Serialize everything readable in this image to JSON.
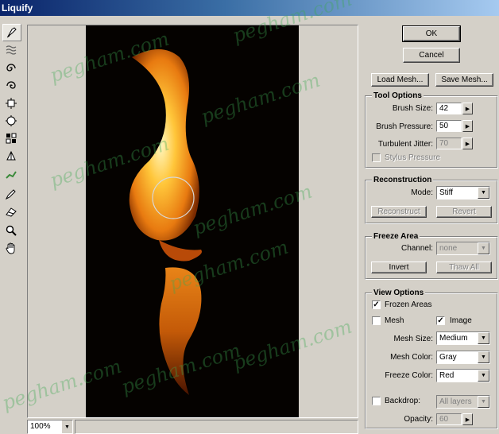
{
  "window": {
    "title": "Liquify"
  },
  "buttons": {
    "ok": "OK",
    "cancel": "Cancel",
    "load_mesh": "Load Mesh...",
    "save_mesh": "Save Mesh..."
  },
  "tool_options": {
    "title": "Tool Options",
    "brush_size_label": "Brush Size:",
    "brush_size_value": "42",
    "brush_pressure_label": "Brush Pressure:",
    "brush_pressure_value": "50",
    "turbulent_jitter_label": "Turbulent Jitter:",
    "turbulent_jitter_value": "70",
    "stylus_pressure_label": "Stylus Pressure"
  },
  "reconstruction": {
    "title": "Reconstruction",
    "mode_label": "Mode:",
    "mode_value": "Stiff",
    "reconstruct_label": "Reconstruct",
    "revert_label": "Revert"
  },
  "freeze_area": {
    "title": "Freeze Area",
    "channel_label": "Channel:",
    "channel_value": "none",
    "invert_label": "Invert",
    "thaw_all_label": "Thaw All"
  },
  "view_options": {
    "title": "View Options",
    "frozen_areas_label": "Frozen Areas",
    "frozen_areas_checked": true,
    "mesh_label": "Mesh",
    "mesh_checked": false,
    "image_label": "Image",
    "image_checked": true,
    "mesh_size_label": "Mesh Size:",
    "mesh_size_value": "Medium",
    "mesh_color_label": "Mesh Color:",
    "mesh_color_value": "Gray",
    "freeze_color_label": "Freeze Color:",
    "freeze_color_value": "Red",
    "backdrop_label": "Backdrop:",
    "backdrop_checked": false,
    "backdrop_value": "All layers",
    "opacity_label": "Opacity:",
    "opacity_value": "60"
  },
  "zoom": {
    "value": "100%"
  },
  "tools": [
    "warp-tool-icon",
    "turbulence-tool-icon",
    "twirl-clockwise-icon",
    "twirl-counterclockwise-icon",
    "pucker-tool-icon",
    "bloat-tool-icon",
    "shift-pixels-icon",
    "reflection-tool-icon",
    "reconstruct-tool-icon",
    "freeze-tool-icon",
    "thaw-tool-icon",
    "zoom-tool-icon",
    "hand-tool-icon"
  ],
  "watermark": "pegham.com"
}
